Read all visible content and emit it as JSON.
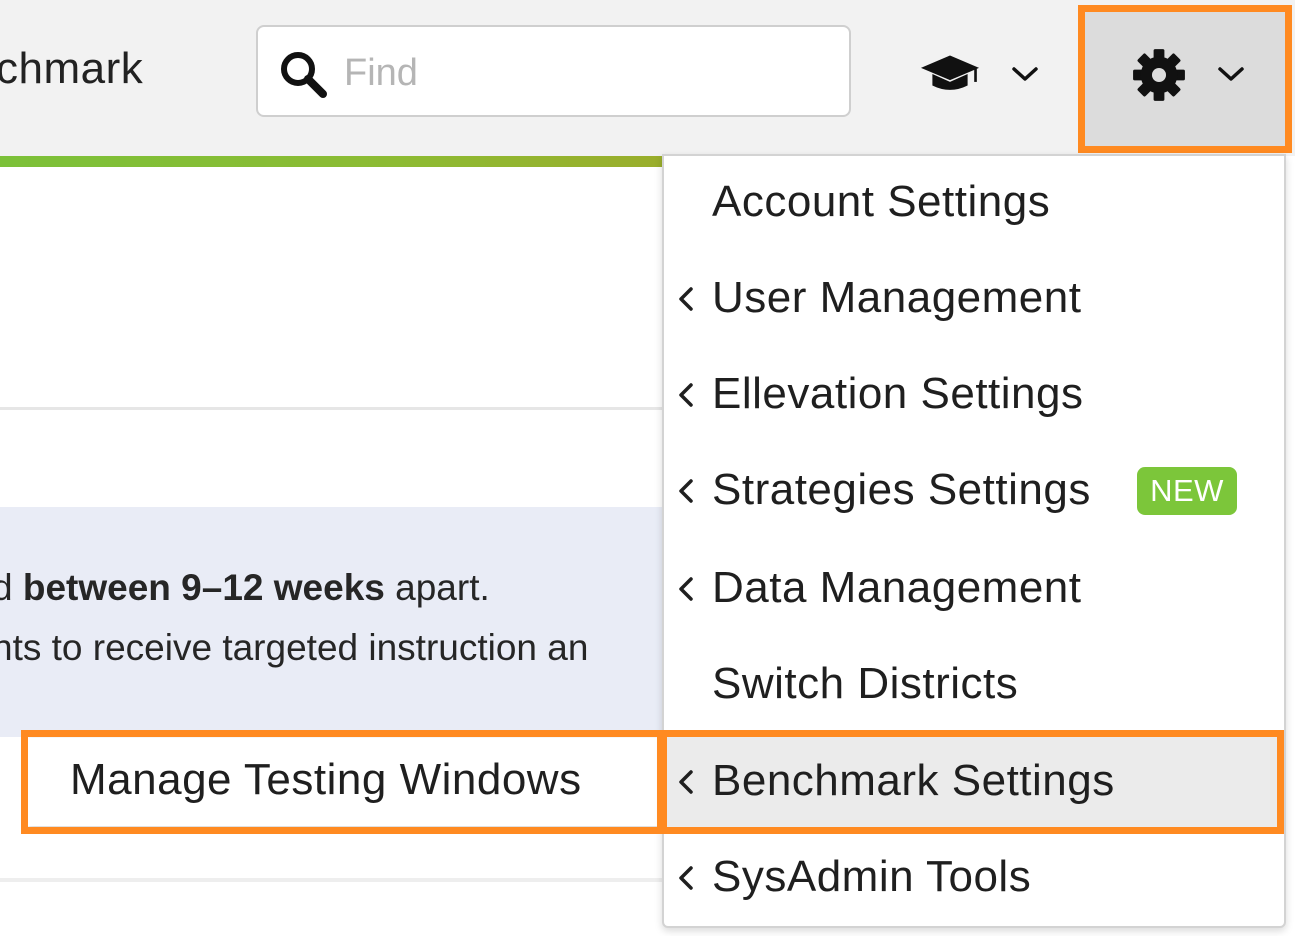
{
  "header": {
    "app_title": "chmark",
    "search": {
      "placeholder": "Find",
      "value": ""
    },
    "learning_menu_icon": "graduation-cap-icon",
    "settings_menu_icon": "gear-icon"
  },
  "content": {
    "info_line_1": {
      "pre": "d ",
      "bold": "between 9–12 weeks",
      "post": " apart."
    },
    "info_line_2": "nts to receive targeted instruction an"
  },
  "settings_menu": {
    "items": [
      {
        "label": "Account Settings",
        "has_submenu": false
      },
      {
        "label": "User Management",
        "has_submenu": true
      },
      {
        "label": "Ellevation Settings",
        "has_submenu": true
      },
      {
        "label": "Strategies Settings",
        "has_submenu": true,
        "badge": "NEW"
      },
      {
        "label": "Data Management",
        "has_submenu": true
      },
      {
        "label": "Switch Districts",
        "has_submenu": false
      },
      {
        "label": "Benchmark Settings",
        "has_submenu": true,
        "active": true
      },
      {
        "label": "SysAdmin Tools",
        "has_submenu": true
      }
    ]
  },
  "benchmark_submenu": {
    "items": [
      {
        "label": "Manage Testing Windows"
      }
    ]
  },
  "colors": {
    "highlight_outline": "#ff8a21",
    "new_badge": "#7cc63a",
    "info_panel": "#e9ecf6"
  }
}
